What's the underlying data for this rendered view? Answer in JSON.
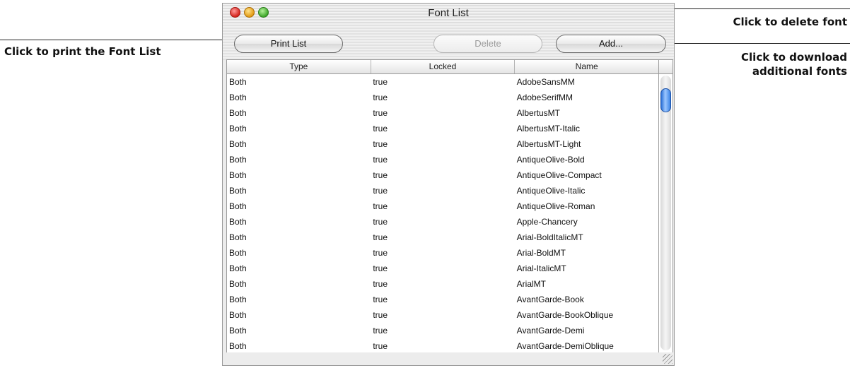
{
  "callouts": {
    "print": "Click to print the Font List",
    "delete": "Click to delete font",
    "add_line1": "Click to download",
    "add_line2": "additional fonts"
  },
  "window": {
    "title": "Font List",
    "traffic_lights": [
      "close-red",
      "minimize-yellow",
      "zoom-green"
    ]
  },
  "toolbar": {
    "print_label": "Print List",
    "delete_label": "Delete",
    "delete_enabled": false,
    "add_label": "Add..."
  },
  "table": {
    "columns": [
      "Type",
      "Locked",
      "Name"
    ],
    "rows": [
      [
        "Both",
        "true",
        "AdobeSansMM"
      ],
      [
        "Both",
        "true",
        "AdobeSerifMM"
      ],
      [
        "Both",
        "true",
        "AlbertusMT"
      ],
      [
        "Both",
        "true",
        "AlbertusMT-Italic"
      ],
      [
        "Both",
        "true",
        "AlbertusMT-Light"
      ],
      [
        "Both",
        "true",
        "AntiqueOlive-Bold"
      ],
      [
        "Both",
        "true",
        "AntiqueOlive-Compact"
      ],
      [
        "Both",
        "true",
        "AntiqueOlive-Italic"
      ],
      [
        "Both",
        "true",
        "AntiqueOlive-Roman"
      ],
      [
        "Both",
        "true",
        "Apple-Chancery"
      ],
      [
        "Both",
        "true",
        "Arial-BoldItalicMT"
      ],
      [
        "Both",
        "true",
        "Arial-BoldMT"
      ],
      [
        "Both",
        "true",
        "Arial-ItalicMT"
      ],
      [
        "Both",
        "true",
        "ArialMT"
      ],
      [
        "Both",
        "true",
        "AvantGarde-Book"
      ],
      [
        "Both",
        "true",
        "AvantGarde-BookOblique"
      ],
      [
        "Both",
        "true",
        "AvantGarde-Demi"
      ],
      [
        "Both",
        "true",
        "AvantGarde-DemiOblique"
      ]
    ]
  },
  "colors": {
    "close": "#d4241d",
    "minimize": "#e29a14",
    "zoom": "#3ea72a",
    "scroll_thumb": "#3b83e6"
  }
}
